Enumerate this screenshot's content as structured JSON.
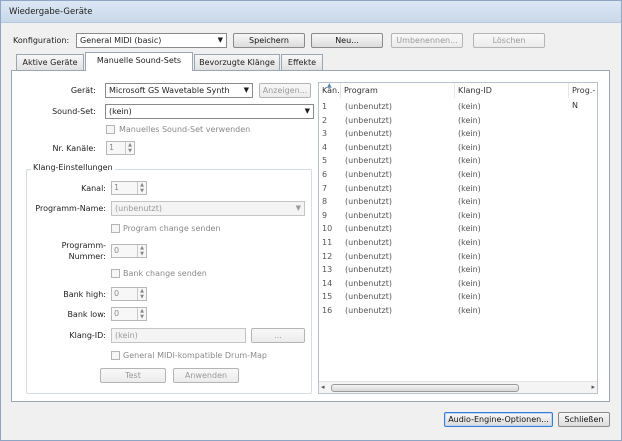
{
  "window": {
    "title": "Wiedergabe-Geräte"
  },
  "toolbar": {
    "config_label": "Konfiguration:",
    "config_value": "General MIDI (basic)",
    "save": "Speichern",
    "new": "Neu...",
    "rename": "Umbenennen...",
    "delete": "Löschen"
  },
  "tabs": [
    {
      "label": "Aktive Geräte"
    },
    {
      "label": "Manuelle Sound-Sets"
    },
    {
      "label": "Bevorzugte Klänge"
    },
    {
      "label": "Effekte"
    }
  ],
  "form": {
    "device_label": "Gerät:",
    "device_value": "Microsoft GS Wavetable Synth",
    "show_button": "Anzeigen...",
    "soundset_label": "Sound-Set:",
    "soundset_value": "(kein)",
    "manual_soundset": "Manuelles Sound-Set verwenden",
    "channels_label": "Nr. Kanäle:",
    "channels_value": "1"
  },
  "sound_settings": {
    "title": "Klang-Einstellungen",
    "channel_label": "Kanal:",
    "channel_value": "1",
    "program_name_label": "Programm-Name:",
    "program_name_value": "(unbenutzt)",
    "program_change": "Program change senden",
    "program_number_label_1": "Programm-",
    "program_number_label_2": "Nummer:",
    "program_number_value": "0",
    "bank_change": "Bank change senden",
    "bank_high_label": "Bank high:",
    "bank_high_value": "0",
    "bank_low_label": "Bank low:",
    "bank_low_value": "0",
    "sound_id_label": "Klang-ID:",
    "sound_id_value": "(kein)",
    "browse": "...",
    "gm_drum_map": "General MIDI-kompatible Drum-Map",
    "test": "Test",
    "apply": "Anwenden"
  },
  "table": {
    "columns": [
      "Kan.",
      "Program",
      "Klang-ID",
      "Prog.-N"
    ],
    "rows": [
      {
        "ch": "1",
        "program": "(unbenutzt)",
        "sound_id": "(kein)"
      },
      {
        "ch": "2",
        "program": "(unbenutzt)",
        "sound_id": "(kein)"
      },
      {
        "ch": "3",
        "program": "(unbenutzt)",
        "sound_id": "(kein)"
      },
      {
        "ch": "4",
        "program": "(unbenutzt)",
        "sound_id": "(kein)"
      },
      {
        "ch": "5",
        "program": "(unbenutzt)",
        "sound_id": "(kein)"
      },
      {
        "ch": "6",
        "program": "(unbenutzt)",
        "sound_id": "(kein)"
      },
      {
        "ch": "7",
        "program": "(unbenutzt)",
        "sound_id": "(kein)"
      },
      {
        "ch": "8",
        "program": "(unbenutzt)",
        "sound_id": "(kein)"
      },
      {
        "ch": "9",
        "program": "(unbenutzt)",
        "sound_id": "(kein)"
      },
      {
        "ch": "10",
        "program": "(unbenutzt)",
        "sound_id": "(kein)"
      },
      {
        "ch": "11",
        "program": "(unbenutzt)",
        "sound_id": "(kein)"
      },
      {
        "ch": "12",
        "program": "(unbenutzt)",
        "sound_id": "(kein)"
      },
      {
        "ch": "13",
        "program": "(unbenutzt)",
        "sound_id": "(kein)"
      },
      {
        "ch": "14",
        "program": "(unbenutzt)",
        "sound_id": "(kein)"
      },
      {
        "ch": "15",
        "program": "(unbenutzt)",
        "sound_id": "(kein)"
      },
      {
        "ch": "16",
        "program": "(unbenutzt)",
        "sound_id": "(kein)"
      }
    ]
  },
  "footer": {
    "audio_engine": "Audio-Engine-Optionen...",
    "close": "Schließen"
  },
  "icons": {
    "dropdown": "chevron-down-icon",
    "spin": "spin-arrows-icon",
    "sort": "sort-up-icon",
    "scroll_left": "scroll-left-icon",
    "scroll_right": "scroll-right-icon"
  }
}
